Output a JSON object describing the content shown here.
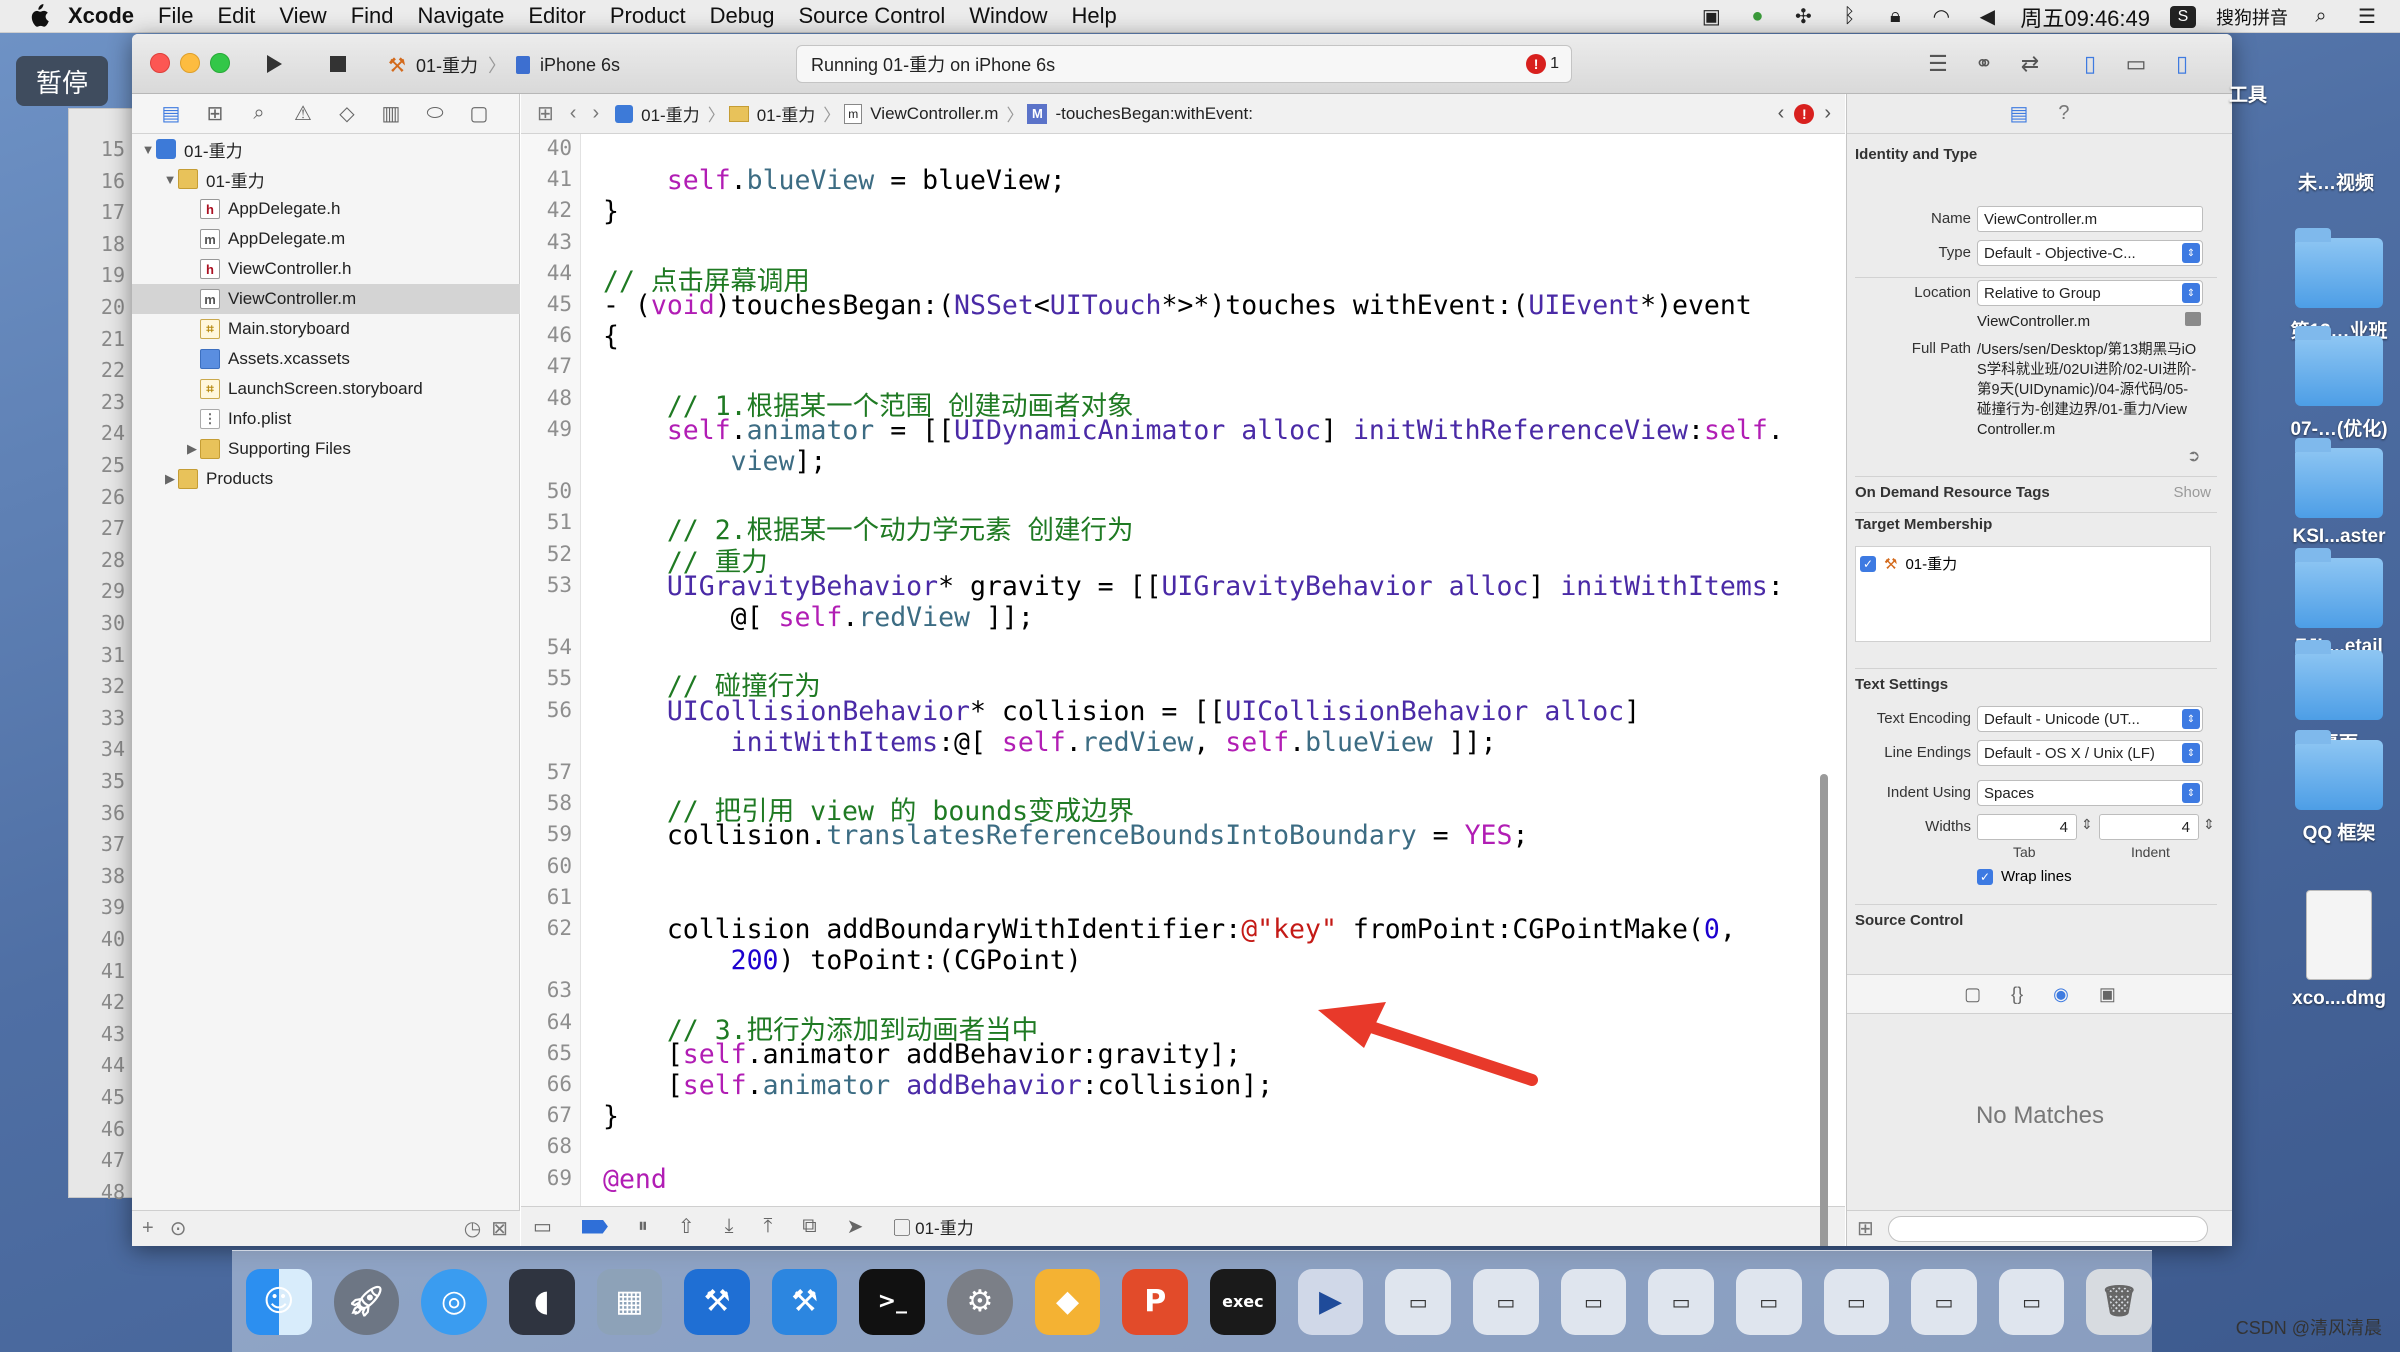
{
  "menubar": {
    "app": "Xcode",
    "items": [
      "File",
      "Edit",
      "View",
      "Find",
      "Navigate",
      "Editor",
      "Product",
      "Debug",
      "Source Control",
      "Window",
      "Help"
    ],
    "clock": "周五09:46:49",
    "ime": "搜狗拼音"
  },
  "overlay": {
    "pause": "暂停"
  },
  "toolbar": {
    "scheme": "01-重力",
    "device": "iPhone 6s",
    "status": "Running 01-重力 on iPhone 6s",
    "error_count": "1"
  },
  "navigator": {
    "items": [
      {
        "label": "01-重力",
        "depth": 0,
        "icon": "proj",
        "disclosure": "▼"
      },
      {
        "label": "01-重力",
        "depth": 1,
        "icon": "folder",
        "disclosure": "▼"
      },
      {
        "label": "AppDelegate.h",
        "depth": 2,
        "icon": "h",
        "disclosure": ""
      },
      {
        "label": "AppDelegate.m",
        "depth": 2,
        "icon": "m",
        "disclosure": ""
      },
      {
        "label": "ViewController.h",
        "depth": 2,
        "icon": "h",
        "disclosure": ""
      },
      {
        "label": "ViewController.m",
        "depth": 2,
        "icon": "m",
        "disclosure": "",
        "selected": true
      },
      {
        "label": "Main.storyboard",
        "depth": 2,
        "icon": "sb",
        "disclosure": ""
      },
      {
        "label": "Assets.xcassets",
        "depth": 2,
        "icon": "assets",
        "disclosure": ""
      },
      {
        "label": "LaunchScreen.storyboard",
        "depth": 2,
        "icon": "sb",
        "disclosure": ""
      },
      {
        "label": "Info.plist",
        "depth": 2,
        "icon": "plist",
        "disclosure": ""
      },
      {
        "label": "Supporting Files",
        "depth": 2,
        "icon": "folder",
        "disclosure": "▶"
      },
      {
        "label": "Products",
        "depth": 1,
        "icon": "folder",
        "disclosure": "▶"
      }
    ]
  },
  "background_window_lines": [
    "15",
    "16",
    "17",
    "18",
    "19",
    "20",
    "21",
    "22",
    "23",
    "24",
    "25",
    "26",
    "27",
    "28",
    "29",
    "30",
    "31",
    "32",
    "33",
    "34",
    "35",
    "36",
    "37",
    "38",
    "39",
    "40",
    "41",
    "42",
    "43",
    "44",
    "45",
    "46",
    "47",
    "48"
  ],
  "jumpbar": {
    "crumbs": [
      "01-重力",
      "01-重力",
      "ViewController.m",
      "-touchesBegan:withEvent:"
    ]
  },
  "editor": {
    "rows": [
      {
        "n": "40",
        "y": 0,
        "seg": []
      },
      {
        "n": "41",
        "y": 1,
        "seg": [
          [
            "    ",
            ""
          ],
          [
            "self",
            "k"
          ],
          [
            ".",
            ""
          ],
          [
            "blueView",
            "p"
          ],
          [
            " = blueView;",
            ""
          ]
        ]
      },
      {
        "n": "42",
        "y": 2,
        "seg": [
          [
            "}",
            ""
          ]
        ]
      },
      {
        "n": "43",
        "y": 3,
        "seg": []
      },
      {
        "n": "44",
        "y": 4,
        "seg": [
          [
            "// 点击屏幕调用",
            "c"
          ]
        ]
      },
      {
        "n": "45",
        "y": 5,
        "seg": [
          [
            "- (",
            ""
          ],
          [
            "void",
            "k"
          ],
          [
            ")touchesBegan:(",
            ""
          ],
          [
            "NSSet",
            "t"
          ],
          [
            "<",
            ""
          ],
          [
            "UITouch",
            "t"
          ],
          [
            "*>*)touches withEvent:(",
            ""
          ],
          [
            "UIEvent",
            "t"
          ],
          [
            "*)event",
            ""
          ]
        ]
      },
      {
        "n": "46",
        "y": 6,
        "seg": [
          [
            "{",
            ""
          ]
        ]
      },
      {
        "n": "47",
        "y": 7,
        "seg": []
      },
      {
        "n": "48",
        "y": 8,
        "seg": [
          [
            "    ",
            ""
          ],
          [
            "// 1.根据某一个范围 创建动画者对象",
            "c"
          ]
        ]
      },
      {
        "n": "49",
        "y": 9,
        "seg": [
          [
            "    ",
            ""
          ],
          [
            "self",
            "k"
          ],
          [
            ".",
            ""
          ],
          [
            "animator",
            "p"
          ],
          [
            " = [[",
            ""
          ],
          [
            "UIDynamicAnimator",
            "t"
          ],
          [
            " ",
            ""
          ],
          [
            "alloc",
            "t"
          ],
          [
            "] ",
            ""
          ],
          [
            "initWithReferenceView",
            "t"
          ],
          [
            ":",
            ""
          ],
          [
            "self",
            "k"
          ],
          [
            ".",
            ""
          ]
        ]
      },
      {
        "n": "",
        "y": 10,
        "seg": [
          [
            "        ",
            ""
          ],
          [
            "view",
            "p"
          ],
          [
            "];",
            ""
          ]
        ]
      },
      {
        "n": "50",
        "y": 11,
        "seg": []
      },
      {
        "n": "51",
        "y": 12,
        "seg": [
          [
            "    ",
            ""
          ],
          [
            "// 2.根据某一个动力学元素 创建行为",
            "c"
          ]
        ]
      },
      {
        "n": "52",
        "y": 13,
        "seg": [
          [
            "    ",
            ""
          ],
          [
            "// 重力",
            "c"
          ]
        ]
      },
      {
        "n": "53",
        "y": 14,
        "seg": [
          [
            "    ",
            ""
          ],
          [
            "UIGravityBehavior",
            "t"
          ],
          [
            "* gravity = [[",
            ""
          ],
          [
            "UIGravityBehavior",
            "t"
          ],
          [
            " ",
            ""
          ],
          [
            "alloc",
            "t"
          ],
          [
            "] ",
            ""
          ],
          [
            "initWithItems",
            "t"
          ],
          [
            ":",
            ""
          ]
        ]
      },
      {
        "n": "",
        "y": 15,
        "seg": [
          [
            "        ",
            ""
          ],
          [
            "@[ ",
            ""
          ],
          [
            "self",
            "k"
          ],
          [
            ".",
            ""
          ],
          [
            "redView",
            "p"
          ],
          [
            " ]];",
            ""
          ]
        ]
      },
      {
        "n": "54",
        "y": 16,
        "seg": []
      },
      {
        "n": "55",
        "y": 17,
        "seg": [
          [
            "    ",
            ""
          ],
          [
            "// 碰撞行为",
            "c"
          ]
        ]
      },
      {
        "n": "56",
        "y": 18,
        "seg": [
          [
            "    ",
            ""
          ],
          [
            "UICollisionBehavior",
            "t"
          ],
          [
            "* collision = [[",
            ""
          ],
          [
            "UICollisionBehavior",
            "t"
          ],
          [
            " ",
            ""
          ],
          [
            "alloc",
            "t"
          ],
          [
            "]",
            ""
          ]
        ]
      },
      {
        "n": "",
        "y": 19,
        "seg": [
          [
            "        ",
            ""
          ],
          [
            "initWithItems",
            "t"
          ],
          [
            ":@[ ",
            ""
          ],
          [
            "self",
            "k"
          ],
          [
            ".",
            ""
          ],
          [
            "redView",
            "p"
          ],
          [
            ", ",
            ""
          ],
          [
            "self",
            "k"
          ],
          [
            ".",
            ""
          ],
          [
            "blueView",
            "p"
          ],
          [
            " ]];",
            ""
          ]
        ]
      },
      {
        "n": "57",
        "y": 20,
        "seg": []
      },
      {
        "n": "58",
        "y": 21,
        "seg": [
          [
            "    ",
            ""
          ],
          [
            "// 把引用 view 的 bounds变成边界",
            "c"
          ]
        ]
      },
      {
        "n": "59",
        "y": 22,
        "seg": [
          [
            "    collision.",
            ""
          ],
          [
            "translatesReferenceBoundsIntoBoundary",
            "p"
          ],
          [
            " = ",
            ""
          ],
          [
            "YES",
            "k"
          ],
          [
            ";",
            ""
          ]
        ]
      },
      {
        "n": "60",
        "y": 23,
        "seg": []
      },
      {
        "n": "61",
        "y": 24,
        "seg": []
      },
      {
        "n": "62",
        "y": 25,
        "seg": [
          [
            "    collision addBoundaryWithIdentifier:",
            ""
          ],
          [
            "@\"key\"",
            "s"
          ],
          [
            " fromPoint:CGPointMake(",
            ""
          ],
          [
            "0",
            "nm"
          ],
          [
            ",",
            ""
          ]
        ]
      },
      {
        "n": "",
        "y": 26,
        "seg": [
          [
            "        ",
            ""
          ],
          [
            "200",
            "nm"
          ],
          [
            ") toPoint:(CGPoint)",
            ""
          ]
        ]
      },
      {
        "n": "63",
        "y": 27,
        "seg": []
      },
      {
        "n": "64",
        "y": 28,
        "seg": [
          [
            "    ",
            ""
          ],
          [
            "// 3.把行为添加到动画者当中",
            "c"
          ]
        ]
      },
      {
        "n": "65",
        "y": 29,
        "seg": [
          [
            "    [",
            ""
          ],
          [
            "self",
            "k"
          ],
          [
            ".animator addBehavior:gravity];",
            ""
          ]
        ]
      },
      {
        "n": "66",
        "y": 30,
        "seg": [
          [
            "    [",
            ""
          ],
          [
            "self",
            "k"
          ],
          [
            ".",
            ""
          ],
          [
            "animator",
            "p"
          ],
          [
            " ",
            ""
          ],
          [
            "addBehavior",
            "t"
          ],
          [
            ":collision];",
            ""
          ]
        ]
      },
      {
        "n": "67",
        "y": 31,
        "seg": [
          [
            "}",
            ""
          ]
        ]
      },
      {
        "n": "68",
        "y": 32,
        "seg": []
      },
      {
        "n": "69",
        "y": 33,
        "seg": [
          [
            "@end",
            "k"
          ]
        ]
      }
    ],
    "bottom_target": "01-重力"
  },
  "inspector": {
    "identity_title": "Identity and Type",
    "name_label": "Name",
    "name_value": "ViewController.m",
    "type_label": "Type",
    "type_value": "Default - Objective-C...",
    "location_label": "Location",
    "location_value": "Relative to Group",
    "location_file": "ViewController.m",
    "fullpath_label": "Full Path",
    "fullpath_value": "/Users/sen/Desktop/第13期黑马iOS学科就业班/02UI进阶/02-UI进阶-第9天(UIDynamic)/04-源代码/05-碰撞行为-创建边界/01-重力/ViewController.m",
    "ondemand_title": "On Demand Resource Tags",
    "ondemand_show": "Show",
    "target_title": "Target Membership",
    "target_item": "01-重力",
    "text_settings_title": "Text Settings",
    "encoding_label": "Text Encoding",
    "encoding_value": "Default - Unicode (UT...",
    "lineend_label": "Line Endings",
    "lineend_value": "Default - OS X / Unix (LF)",
    "indent_label": "Indent Using",
    "indent_value": "Spaces",
    "widths_label": "Widths",
    "tab_value": "4",
    "indent_value2": "4",
    "tab_caption": "Tab",
    "indent_caption": "Indent",
    "wrap_label": "Wrap lines",
    "source_control_title": "Source Control",
    "no_matches": "No Matches"
  },
  "desktop": {
    "labels": [
      "工具",
      "未…视频",
      "第13…业班",
      "07-…(优化)",
      "KSI...aster",
      "ZJL...etail",
      "桌面",
      "QQ 框架",
      "xco....dmg"
    ]
  },
  "watermark": "CSDN @清风清晨"
}
